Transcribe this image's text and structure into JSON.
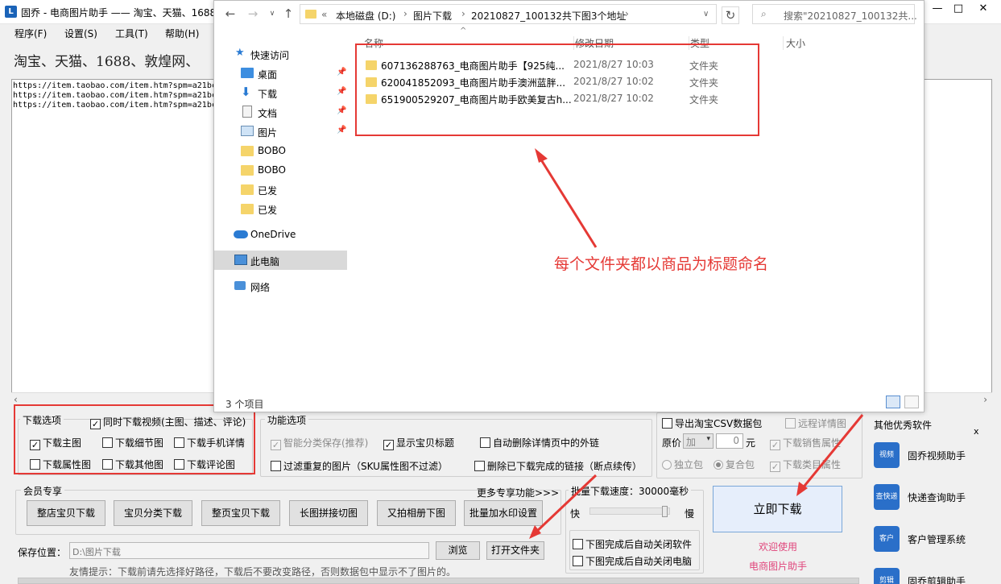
{
  "app": {
    "title": "固乔 - 电商图片助手 —— 淘宝、天猫、1688",
    "logo": "L",
    "menu": [
      "程序(F)",
      "设置(S)",
      "工具(T)",
      "帮助(H)"
    ],
    "banner": "淘宝、天猫、1688、敦煌网、",
    "urls": [
      "https://item.taobao.com/item.htm?spm=a21bc",
      "https://item.taobao.com/item.htm?spm=a21bc",
      "https://item.taobao.com/item.htm?spm=a21bc"
    ]
  },
  "explorer": {
    "breadcrumb": [
      "«",
      "本地磁盘 (D:)",
      "图片下载",
      "20210827_100132共下图3个地址"
    ],
    "search_placeholder": "搜索\"20210827_100132共...",
    "nav": [
      {
        "label": "快速访问",
        "icon": "star-icon"
      },
      {
        "label": "桌面",
        "icon": "desktop-icon",
        "pinned": true
      },
      {
        "label": "下载",
        "icon": "download-icon",
        "pinned": true
      },
      {
        "label": "文档",
        "icon": "document-icon",
        "pinned": true
      },
      {
        "label": "图片",
        "icon": "picture-icon",
        "pinned": true
      },
      {
        "label": "BOBO",
        "icon": "folder-icon"
      },
      {
        "label": "BOBO",
        "icon": "folder-icon"
      },
      {
        "label": "已发",
        "icon": "folder-icon"
      },
      {
        "label": "已发",
        "icon": "folder-icon"
      },
      {
        "label": "OneDrive",
        "icon": "cloud-icon"
      },
      {
        "label": "此电脑",
        "icon": "computer-icon"
      },
      {
        "label": "网络",
        "icon": "network-icon"
      }
    ],
    "columns": [
      "名称",
      "修改日期",
      "类型",
      "大小"
    ],
    "files": [
      {
        "name": "607136288763_电商图片助手【925纯...",
        "date": "2021/8/27 10:03",
        "type": "文件夹"
      },
      {
        "name": "620041852093_电商图片助手澳洲蓝胖...",
        "date": "2021/8/27 10:02",
        "type": "文件夹"
      },
      {
        "name": "651900529207_电商图片助手欧美复古h...",
        "date": "2021/8/27 10:02",
        "type": "文件夹"
      }
    ],
    "status": "3 个项目",
    "annotation": "每个文件夹都以商品为标题命名"
  },
  "download_options": {
    "label": "下载选项",
    "video": {
      "label": "同时下载视频(主图、描述、评论)",
      "checked": true
    },
    "items": [
      {
        "label": "下载主图",
        "checked": true
      },
      {
        "label": "下载细节图",
        "checked": false
      },
      {
        "label": "下载手机详情",
        "checked": false
      },
      {
        "label": "下载属性图",
        "checked": false
      },
      {
        "label": "下载其他图",
        "checked": false
      },
      {
        "label": "下载评论图",
        "checked": false
      }
    ]
  },
  "function_options": {
    "label": "功能选项",
    "smart_save": "智能分类保存(推荐)",
    "show_title": "显示宝贝标题",
    "auto_delete": "自动删除详情页中的外链",
    "filter_dup": "过滤重复的图片（SKU属性图不过滤）",
    "delete_done": "删除已下载完成的链接（断点续传）"
  },
  "export": {
    "csv": "导出淘宝CSV数据包",
    "remote": "远程详情图",
    "price_label": "原价",
    "price_op": "加",
    "price_value": "0",
    "price_unit": "元",
    "sales_attr": "下载销售属性",
    "single": "独立包",
    "composite": "复合包",
    "category_attr": "下载类目属性"
  },
  "member": {
    "label": "会员专享",
    "more": "更多专享功能>>>",
    "buttons": [
      "整店宝贝下载",
      "宝贝分类下载",
      "整页宝贝下载",
      "长图拼接切图",
      "又拍相册下图",
      "批量加水印设置"
    ]
  },
  "speed": {
    "label": "批量下载速度：30000毫秒",
    "fast": "快",
    "slow": "慢",
    "level": 0.97
  },
  "after": [
    "下图完成后自动关闭软件",
    "下图完成后自动关闭电脑"
  ],
  "download_now": "立即下载",
  "welcome": [
    "欢迎使用",
    "电商图片助手"
  ],
  "save": {
    "label": "保存位置：",
    "path": "D:\\图片下载",
    "browse": "浏览",
    "open": "打开文件夹"
  },
  "tip": "友情提示：下载前请先选择好路径，下载后不要改变路径，否则数据包中显示不了图片的。",
  "other": {
    "label": "其他优秀软件",
    "close": "x",
    "items": [
      {
        "label": "固乔视频助手",
        "icon_text": "视频"
      },
      {
        "label": "快递查询助手",
        "icon_text": "查快递"
      },
      {
        "label": "客户管理系统",
        "icon_text": "客户"
      },
      {
        "label": "固乔剪辑助手",
        "icon_text": "剪辑"
      }
    ]
  },
  "colors": {
    "annotation": "#e53935",
    "accent": "#1a63b8"
  }
}
